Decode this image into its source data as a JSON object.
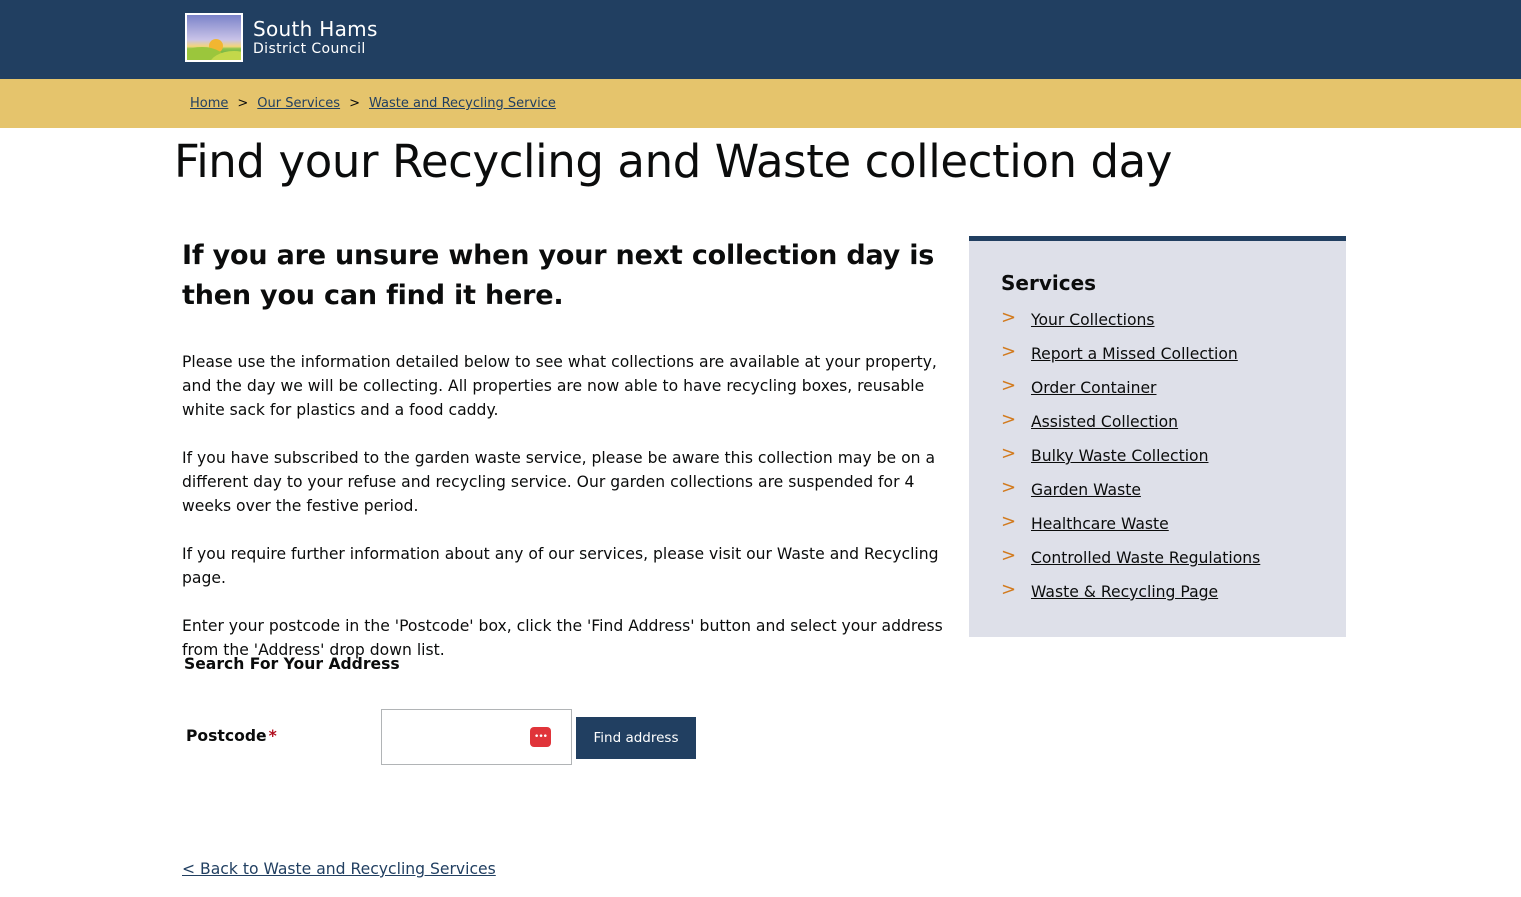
{
  "header": {
    "logo_line1": "South Hams",
    "logo_line2": "District Council"
  },
  "breadcrumb": {
    "items": [
      "Home",
      "Our Services",
      "Waste and Recycling Service"
    ],
    "separator": ">"
  },
  "page_title": "Find your Recycling and Waste collection day",
  "main": {
    "lead": "If you are unsure when your next collection day is then you can find it here.",
    "paragraphs": [
      "Please use the information detailed below to see what collections are available at your property, and the day we will be collecting. All properties are now able to have recycling boxes, reusable white sack for plastics and a food caddy.",
      "If you have subscribed to the garden waste service, please be aware this collection may be on a different day to your refuse and recycling service. Our garden collections are suspended for 4 weeks over the festive period.",
      "If you require further information about any of our services, please visit our Waste and Recycling page.",
      "Enter your postcode in the 'Postcode' box, click the 'Find Address' button and select your address from the 'Address' drop down list."
    ]
  },
  "search": {
    "heading": "Search For Your Address",
    "postcode_label": "Postcode",
    "required_marker": "*",
    "postcode_value": "",
    "button_label": "Find address",
    "password_manager_icon": "•••"
  },
  "back_link": "< Back to Waste and Recycling Services",
  "sidebar": {
    "title": "Services",
    "chevron": ">",
    "items": [
      "Your Collections",
      "Report a Missed Collection",
      "Order Container",
      "Assisted Collection",
      "Bulky Waste Collection",
      "Garden Waste",
      "Healthcare Waste",
      "Controlled Waste Regulations",
      "Waste & Recycling Page"
    ]
  },
  "colors": {
    "header_bg": "#213f61",
    "breadcrumb_bg": "#e5c46c",
    "sidebar_bg": "#dee0e9",
    "chevron": "#d27a1d",
    "required": "#b10e1e"
  }
}
